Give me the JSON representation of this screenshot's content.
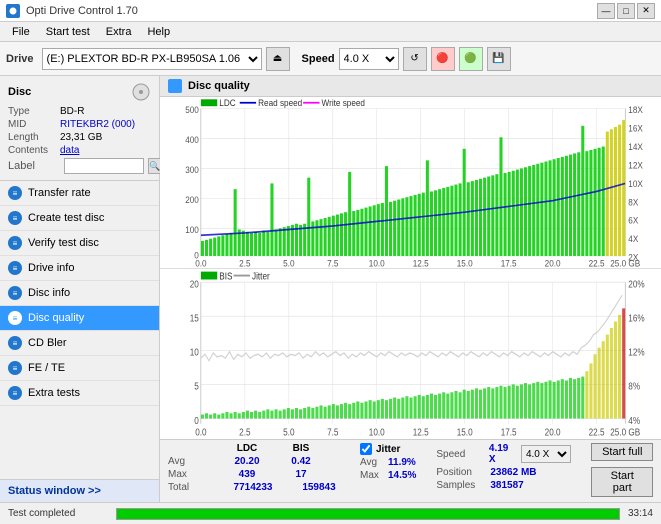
{
  "titleBar": {
    "title": "Opti Drive Control 1.70",
    "minimize": "—",
    "maximize": "□",
    "close": "✕"
  },
  "menu": {
    "items": [
      "File",
      "Start test",
      "Extra",
      "Help"
    ]
  },
  "toolbar": {
    "driveLabel": "Drive",
    "driveName": "(E:) PLEXTOR BD-R  PX-LB950SA 1.06",
    "speedLabel": "Speed",
    "speedValue": "4.0 X"
  },
  "sidebar": {
    "disc": {
      "type_key": "Type",
      "type_val": "BD-R",
      "mid_key": "MID",
      "mid_val": "RITEKBR2 (000)",
      "length_key": "Length",
      "length_val": "23,31 GB",
      "contents_key": "Contents",
      "contents_val": "data",
      "label_key": "Label",
      "label_val": ""
    },
    "navItems": [
      {
        "id": "transfer-rate",
        "label": "Transfer rate",
        "icon": "≡"
      },
      {
        "id": "create-test-disc",
        "label": "Create test disc",
        "icon": "≡"
      },
      {
        "id": "verify-test-disc",
        "label": "Verify test disc",
        "icon": "≡"
      },
      {
        "id": "drive-info",
        "label": "Drive info",
        "icon": "≡"
      },
      {
        "id": "disc-info",
        "label": "Disc info",
        "icon": "≡"
      },
      {
        "id": "disc-quality",
        "label": "Disc quality",
        "icon": "≡",
        "active": true
      },
      {
        "id": "cd-bler",
        "label": "CD Bler",
        "icon": "≡"
      },
      {
        "id": "fe-te",
        "label": "FE / TE",
        "icon": "≡"
      },
      {
        "id": "extra-tests",
        "label": "Extra tests",
        "icon": "≡"
      }
    ],
    "statusWindow": "Status window >>"
  },
  "discQuality": {
    "title": "Disc quality",
    "legendItems": [
      {
        "label": "LDC",
        "color": "#00aa00"
      },
      {
        "label": "Read speed",
        "color": "#0000cc"
      },
      {
        "label": "Write speed",
        "color": "#ff00ff"
      }
    ],
    "legend2Items": [
      {
        "label": "BIS",
        "color": "#00aa00"
      },
      {
        "label": "Jitter",
        "color": "#888888"
      }
    ],
    "chart1": {
      "yMax": 500,
      "yLabels": [
        "500",
        "400",
        "300",
        "200",
        "100",
        "0"
      ],
      "yLabelsRight": [
        "18X",
        "16X",
        "14X",
        "12X",
        "10X",
        "8X",
        "6X",
        "4X",
        "2X"
      ],
      "xLabels": [
        "0.0",
        "2.5",
        "5.0",
        "7.5",
        "10.0",
        "12.5",
        "15.0",
        "17.5",
        "20.0",
        "22.5",
        "25.0 GB"
      ]
    },
    "chart2": {
      "yMax": 20,
      "yLabels": [
        "20",
        "15",
        "10",
        "5",
        "0"
      ],
      "yLabelsRight": [
        "20%",
        "16%",
        "12%",
        "8%",
        "4%"
      ],
      "xLabels": [
        "0.0",
        "2.5",
        "5.0",
        "7.5",
        "10.0",
        "12.5",
        "15.0",
        "17.5",
        "20.0",
        "22.5",
        "25.0 GB"
      ]
    }
  },
  "stats": {
    "ldcHeader": "LDC",
    "bisHeader": "BIS",
    "jitterHeader": "Jitter",
    "avg_ldc": "20.20",
    "avg_bis": "0.42",
    "avg_jitter": "11.9%",
    "max_ldc": "439",
    "max_bis": "17",
    "max_jitter": "14.5%",
    "total_ldc": "7714233",
    "total_bis": "159843",
    "speedLabel": "Speed",
    "speedVal": "4.19 X",
    "speedSelectVal": "4.0 X",
    "positionLabel": "Position",
    "positionVal": "23862 MB",
    "samplesLabel": "Samples",
    "samplesVal": "381587",
    "btnStartFull": "Start full",
    "btnStartPart": "Start part",
    "jitterChecked": true,
    "jitterLabel": "Jitter"
  },
  "statusBar": {
    "text": "Test completed",
    "progress": 100,
    "time": "33:14"
  }
}
